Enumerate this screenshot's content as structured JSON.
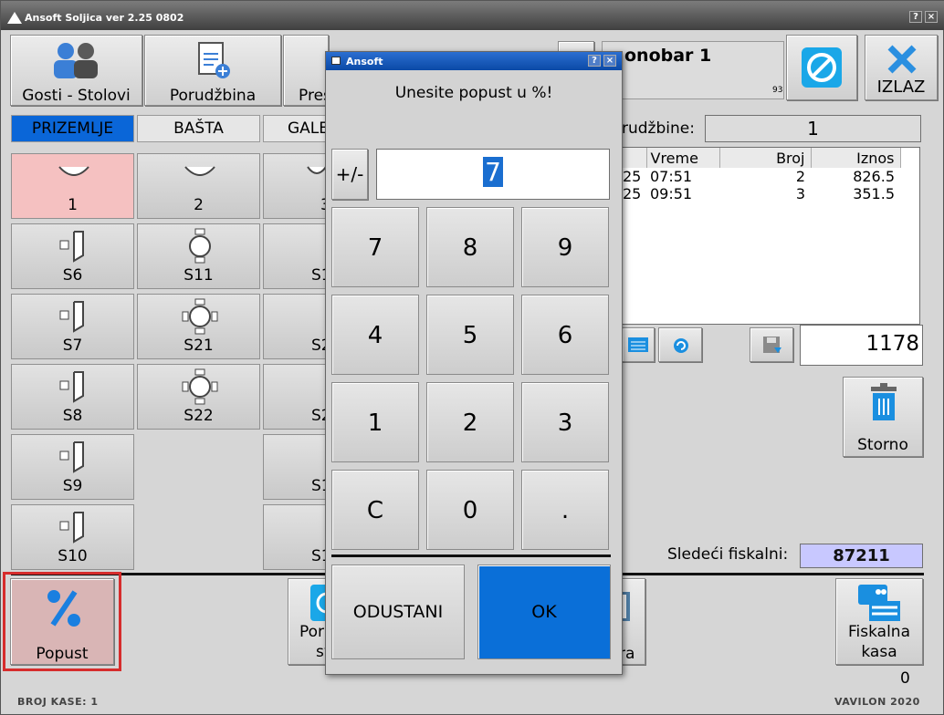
{
  "window": {
    "title": "Ansoft Soljica ver 2.25 0802",
    "help": "?",
    "close": "×"
  },
  "toolbar": {
    "guests": "Gosti - Stolovi",
    "order": "Porudžbina",
    "third": "Pres",
    "waiter": "onobar 1",
    "waiter_small": "93",
    "exit": "IZLAZ"
  },
  "tabs": [
    {
      "label": "PRIZEMLJE"
    },
    {
      "label": "BAŠTA"
    },
    {
      "label": "GALE"
    }
  ],
  "tables": {
    "c1": [
      "1",
      "S6",
      "S7",
      "S8",
      "S9",
      "S10"
    ],
    "c2": [
      "2",
      "S11",
      "S21",
      "S22"
    ],
    "c3": [
      "3",
      "S1",
      "S2",
      "S2",
      "S1",
      "S1"
    ]
  },
  "orders": {
    "label": "rudžbine:",
    "count": "1",
    "headers": [
      "Vreme",
      "Broj",
      "Iznos"
    ],
    "rows": [
      {
        "d": "25",
        "time": "07:51",
        "num": "2",
        "amount": "826.5"
      },
      {
        "d": "25",
        "time": "09:51",
        "num": "3",
        "amount": "351.5"
      }
    ],
    "total": "1178"
  },
  "storno": "Storno",
  "fiscal": {
    "label": "Sledeći fiskalni:",
    "value": "87211"
  },
  "bottom": {
    "popust": "Popust",
    "mid1": "Por",
    "mid2": "sv",
    "mid3": "ra",
    "fiskalna1": "Fiskalna",
    "fiskalna2": "kasa",
    "zero": "0"
  },
  "status": {
    "left": "BROJ KASE: 1",
    "right": "VAVILON 2020"
  },
  "dialog": {
    "title": "Ansoft",
    "help": "?",
    "close": "×",
    "prompt": "Unesite popust u %!",
    "sign": "+/-",
    "value": "7",
    "keys": [
      "7",
      "8",
      "9",
      "4",
      "5",
      "6",
      "1",
      "2",
      "3",
      "C",
      "0",
      "."
    ],
    "cancel": "ODUSTANI",
    "ok": "OK"
  },
  "colors": {
    "accent": "#0a66d8",
    "selected_table": "#f5c1c1",
    "fiscal_bg": "#c8c8ff",
    "highlight": "#d62c2c"
  }
}
